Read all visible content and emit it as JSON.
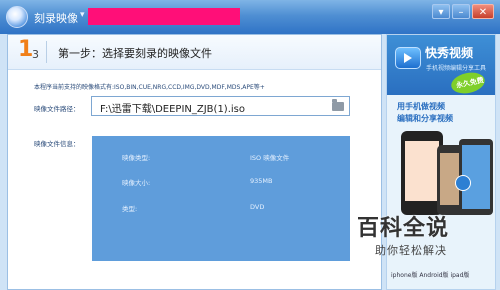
{
  "window": {
    "title": "刻录映像",
    "title_caret": "▾",
    "controls": {
      "menu": "▾",
      "minimize": "–",
      "close": "✕"
    }
  },
  "step": {
    "big_number": "1",
    "small_number": "3",
    "title": "第一步：选择要刻录的映像文件"
  },
  "formats_text": "本程序当前支持的映像格式有:ISO,BIN,CUE,NRG,CCD,IMG,DVD,MDF,MDS,APE等+",
  "image_path": {
    "label": "映像文件路径：",
    "value": "F:\\迅雷下载\\DEEPIN_ZJB(1).iso",
    "folder_icon": "folder-icon"
  },
  "image_info": {
    "label": "映像文件信息：",
    "rows": [
      {
        "key": "映像类型:",
        "value": "ISO 映像文件"
      },
      {
        "key": "映像大小:",
        "value": "935MB"
      },
      {
        "key": "类型:",
        "value": "DVD"
      }
    ]
  },
  "ad": {
    "title": "快秀视频",
    "subtitle": "手机视频编辑分享工具",
    "badge": "永久免费",
    "line1": "用手机做视频",
    "line2": "编辑和分享视频",
    "footer": "iphone版 Android版 ipad版"
  },
  "watermark": {
    "big": "百科全说",
    "small": "助你轻松解决"
  }
}
